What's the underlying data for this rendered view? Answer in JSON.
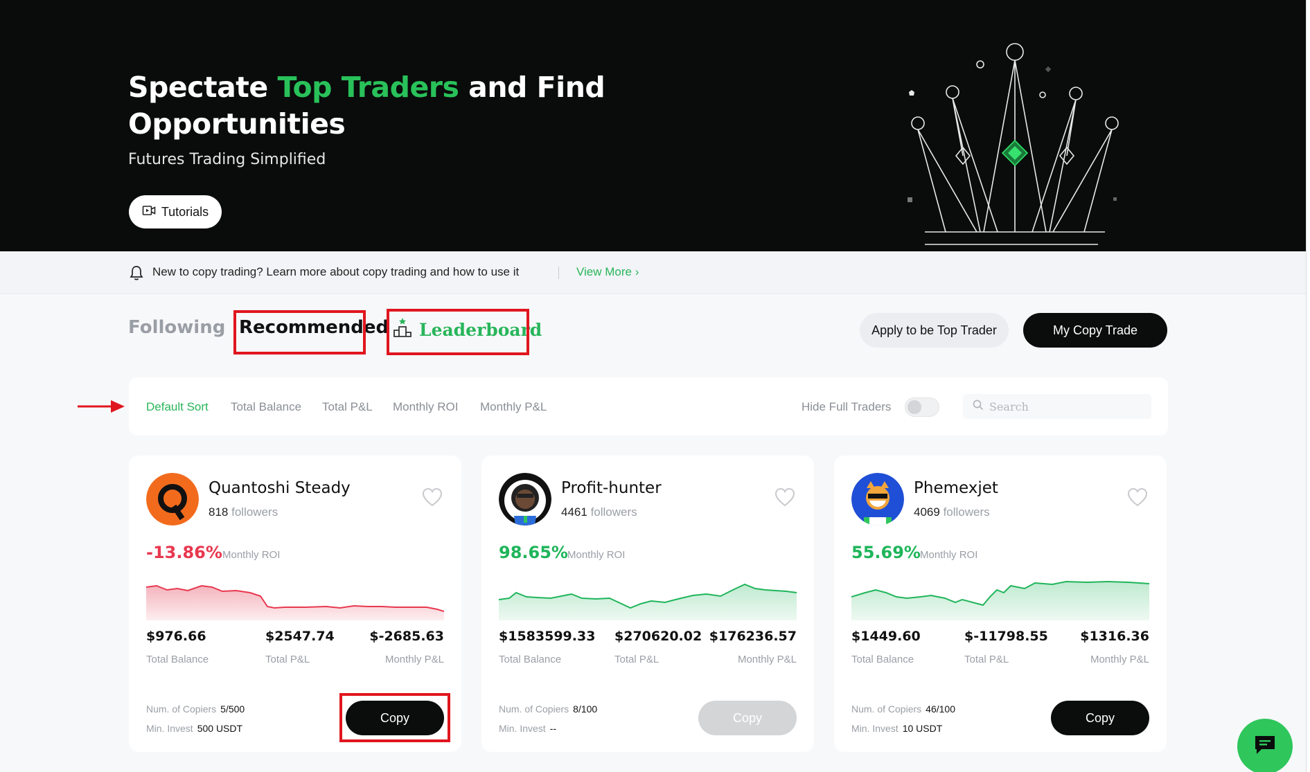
{
  "hero": {
    "title_part1": "Spectate ",
    "title_accent": "Top Traders",
    "title_part2": " and Find Opportunities",
    "subtitle": "Futures Trading Simplified",
    "tutorials_label": "Tutorials"
  },
  "notice": {
    "text": "New to copy trading? Learn more about copy trading and how to use it",
    "link": "View More"
  },
  "tabs": {
    "following": "Following",
    "recommended": "Recommended",
    "leaderboard": "Leaderboard"
  },
  "actions": {
    "apply": "Apply to be Top Trader",
    "my_copy": "My Copy Trade"
  },
  "sort": {
    "items": [
      "Default Sort",
      "Total Balance",
      "Total P&L",
      "Monthly ROI",
      "Monthly P&L"
    ],
    "active": "Default Sort",
    "hide_full": "Hide Full Traders",
    "search_placeholder": "Search"
  },
  "colors": {
    "green": "#29b55a",
    "red": "#e8384f",
    "black": "#0b0c0c"
  },
  "traders": [
    {
      "name": "Quantoshi Steady",
      "followers": "818",
      "followers_label": "followers",
      "roi": "-13.86%",
      "roi_label": "Monthly ROI",
      "trend": "down",
      "total_balance": "$976.66",
      "total_pl": "$2547.74",
      "monthly_pl": "$-2685.63",
      "total_balance_label": "Total Balance",
      "total_pl_label": "Total P&L",
      "monthly_pl_label": "Monthly P&L",
      "copiers_label": "Num. of Copiers",
      "copiers": "5/500",
      "min_invest_label": "Min. Invest",
      "min_invest": "500 USDT",
      "copy_label": "Copy",
      "copy_enabled": true
    },
    {
      "name": "Profit-hunter",
      "followers": "4461",
      "followers_label": "followers",
      "roi": "98.65%",
      "roi_label": "Monthly ROI",
      "trend": "up",
      "total_balance": "$1583599.33",
      "total_pl": "$270620.02",
      "monthly_pl": "$176236.57",
      "total_balance_label": "Total Balance",
      "total_pl_label": "Total P&L",
      "monthly_pl_label": "Monthly P&L",
      "copiers_label": "Num. of Copiers",
      "copiers": "8/100",
      "min_invest_label": "Min. Invest",
      "min_invest": "--",
      "copy_label": "Copy",
      "copy_enabled": false
    },
    {
      "name": "Phemexjet",
      "followers": "4069",
      "followers_label": "followers",
      "roi": "55.69%",
      "roi_label": "Monthly ROI",
      "trend": "up",
      "total_balance": "$1449.60",
      "total_pl": "$-11798.55",
      "monthly_pl": "$1316.36",
      "total_balance_label": "Total Balance",
      "total_pl_label": "Total P&L",
      "monthly_pl_label": "Monthly P&L",
      "copiers_label": "Num. of Copiers",
      "copiers": "46/100",
      "min_invest_label": "Min. Invest",
      "min_invest": "10 USDT",
      "copy_label": "Copy",
      "copy_enabled": true
    }
  ]
}
